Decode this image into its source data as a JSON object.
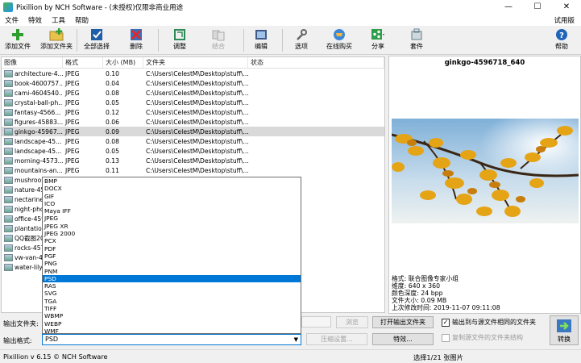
{
  "window": {
    "title": "Pixillion by NCH Software - (未授权)仅限非商业用途",
    "minimize": "—",
    "maximize": "☐",
    "close": "✕"
  },
  "menu": {
    "items": [
      "文件",
      "特效",
      "工具",
      "帮助"
    ],
    "trial": "试用版"
  },
  "toolbar": {
    "add_file": "添加文件",
    "add_folder": "添加文件夹",
    "select_all": "全部选择",
    "delete": "删除",
    "resize": "调整",
    "combine": "结合",
    "edit": "编辑",
    "options": "选项",
    "buy_online": "在线购买",
    "share": "分享",
    "suite": "套件",
    "help": "帮助"
  },
  "list": {
    "headers": [
      "图像",
      "格式",
      "大小 (MB)",
      "文件夹",
      "状态"
    ],
    "rows": [
      {
        "name": "architecture-4...",
        "format": "JPEG",
        "size": "0.10",
        "folder": "C:\\Users\\CelestM\\Desktop\\stuff\\...",
        "selected": false
      },
      {
        "name": "book-4600757...",
        "format": "JPEG",
        "size": "0.04",
        "folder": "C:\\Users\\CelestM\\Desktop\\stuff\\...",
        "selected": false
      },
      {
        "name": "cami-4604540...",
        "format": "JPEG",
        "size": "0.08",
        "folder": "C:\\Users\\CelestM\\Desktop\\stuff\\...",
        "selected": false
      },
      {
        "name": "crystal-ball-ph...",
        "format": "JPEG",
        "size": "0.05",
        "folder": "C:\\Users\\CelestM\\Desktop\\stuff\\...",
        "selected": false
      },
      {
        "name": "fantasy-4566...",
        "format": "JPEG",
        "size": "0.12",
        "folder": "C:\\Users\\CelestM\\Desktop\\stuff\\...",
        "selected": false
      },
      {
        "name": "figures-45883...",
        "format": "JPEG",
        "size": "0.06",
        "folder": "C:\\Users\\CelestM\\Desktop\\stuff\\...",
        "selected": false
      },
      {
        "name": "ginkgo-45967...",
        "format": "JPEG",
        "size": "0.09",
        "folder": "C:\\Users\\CelestM\\Desktop\\stuff\\...",
        "selected": true
      },
      {
        "name": "landscape-45...",
        "format": "JPEG",
        "size": "0.08",
        "folder": "C:\\Users\\CelestM\\Desktop\\stuff\\...",
        "selected": false
      },
      {
        "name": "landscape-45...",
        "format": "JPEG",
        "size": "0.05",
        "folder": "C:\\Users\\CelestM\\Desktop\\stuff\\...",
        "selected": false
      },
      {
        "name": "morning-4573...",
        "format": "JPEG",
        "size": "0.13",
        "folder": "C:\\Users\\CelestM\\Desktop\\stuff\\...",
        "selected": false
      },
      {
        "name": "mountains-an...",
        "format": "JPEG",
        "size": "0.11",
        "folder": "C:\\Users\\CelestM\\Desktop\\stuff\\...",
        "selected": false
      },
      {
        "name": "mushroom-...",
        "format": "",
        "size": "",
        "folder": "",
        "selected": false
      },
      {
        "name": "nature-456...",
        "format": "",
        "size": "",
        "folder": "",
        "selected": false
      },
      {
        "name": "nectarine-...",
        "format": "",
        "size": "",
        "folder": "",
        "selected": false
      },
      {
        "name": "night-photo...",
        "format": "",
        "size": "",
        "folder": "",
        "selected": false
      },
      {
        "name": "office-4598...",
        "format": "",
        "size": "",
        "folder": "",
        "selected": false
      },
      {
        "name": "plantation-...",
        "format": "",
        "size": "",
        "folder": "",
        "selected": false
      },
      {
        "name": "QQ截图20...",
        "format": "",
        "size": "",
        "folder": "",
        "selected": false
      },
      {
        "name": "rocks-4574...",
        "format": "",
        "size": "",
        "folder": "",
        "selected": false
      },
      {
        "name": "vw-van-46...",
        "format": "",
        "size": "",
        "folder": "",
        "selected": false
      },
      {
        "name": "water-lily-...",
        "format": "",
        "size": "",
        "folder": "",
        "selected": false
      }
    ]
  },
  "preview": {
    "title": "ginkgo-4596718_640",
    "info": [
      "格式: 联合图像专家小组",
      "维度: 640 x 360",
      "颜色深度: 24 bpp",
      "文件大小: 0.09 MB",
      "上次修改时间: 2019-11-07 09:11:08"
    ]
  },
  "format_dropdown": {
    "options": [
      "BMP",
      "DOCX",
      "GIF",
      "ICO",
      "Maya IFF",
      "JPEG",
      "JPEG XR",
      "JPEG 2000",
      "PCX",
      "PDF",
      "PGF",
      "PNG",
      "PNM",
      "PSD",
      "RAS",
      "SVG",
      "TGA",
      "TIFF",
      "WBMP",
      "WEBP",
      "WMF"
    ],
    "highlighted": "PSD",
    "selected": "PSD"
  },
  "bottom": {
    "output_folder_label": "输出文件夹:",
    "output_format_label": "输出格式:",
    "browse": "浏览",
    "open_output": "打开输出文件夹",
    "compression": "压缩设置...",
    "effects": "特效...",
    "chk_same_folder": "输出到与源文件相同的文件夹",
    "chk_copy_structure": "复制源文件的文件夹结构",
    "convert": "转换"
  },
  "status": {
    "left": "Pixillion v 6.15 © NCH Software",
    "right": "选择1/21 张图片"
  }
}
